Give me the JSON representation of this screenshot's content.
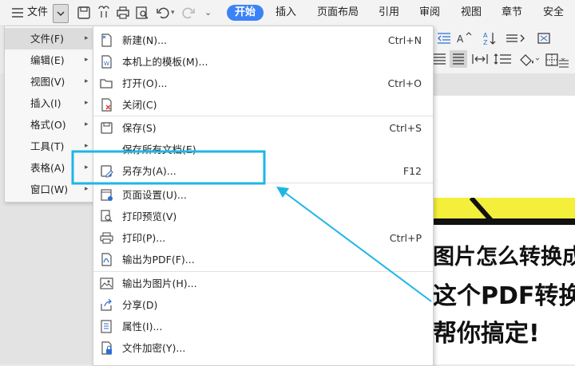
{
  "toolbar": {
    "menu_label": "文件",
    "tabs": [
      "开始",
      "插入",
      "页面布局",
      "引用",
      "审阅",
      "视图",
      "章节",
      "安全"
    ]
  },
  "submenu": [
    {
      "label": "文件(F)"
    },
    {
      "label": "编辑(E)"
    },
    {
      "label": "视图(V)"
    },
    {
      "label": "插入(I)"
    },
    {
      "label": "格式(O)"
    },
    {
      "label": "工具(T)"
    },
    {
      "label": "表格(A)"
    },
    {
      "label": "窗口(W)"
    }
  ],
  "file_menu": [
    {
      "label": "新建(N)...",
      "shortcut": "Ctrl+N",
      "icon": "new-document-icon"
    },
    {
      "label": "本机上的模板(M)...",
      "shortcut": "",
      "icon": "template-icon"
    },
    {
      "label": "打开(O)...",
      "shortcut": "Ctrl+O",
      "icon": "folder-open-icon"
    },
    {
      "label": "关闭(C)",
      "shortcut": "",
      "icon": "close-document-icon"
    },
    {
      "label": "保存(S)",
      "shortcut": "Ctrl+S",
      "icon": "save-icon"
    },
    {
      "label": "保存所有文档(E)",
      "shortcut": "",
      "icon": ""
    },
    {
      "label": "另存为(A)...",
      "shortcut": "F12",
      "icon": "save-as-icon"
    },
    {
      "label": "页面设置(U)...",
      "shortcut": "",
      "icon": "page-setup-icon"
    },
    {
      "label": "打印预览(V)",
      "shortcut": "",
      "icon": "print-preview-icon"
    },
    {
      "label": "打印(P)...",
      "shortcut": "Ctrl+P",
      "icon": "print-icon"
    },
    {
      "label": "输出为PDF(F)...",
      "shortcut": "",
      "icon": "export-pdf-icon"
    },
    {
      "label": "输出为图片(H)...",
      "shortcut": "",
      "icon": "export-image-icon"
    },
    {
      "label": "分享(D)",
      "shortcut": "",
      "icon": "share-icon"
    },
    {
      "label": "属性(I)...",
      "shortcut": "",
      "icon": "properties-icon"
    },
    {
      "label": "文件加密(Y)...",
      "shortcut": "",
      "icon": "encrypt-icon"
    }
  ],
  "document": {
    "lines": [
      "图片怎么转换成P",
      "这个PDF转换",
      "帮你搞定!"
    ]
  },
  "colors": {
    "accent": "#3b82f6",
    "highlight": "#1fb6e6",
    "banner": "#f4ef3a"
  }
}
